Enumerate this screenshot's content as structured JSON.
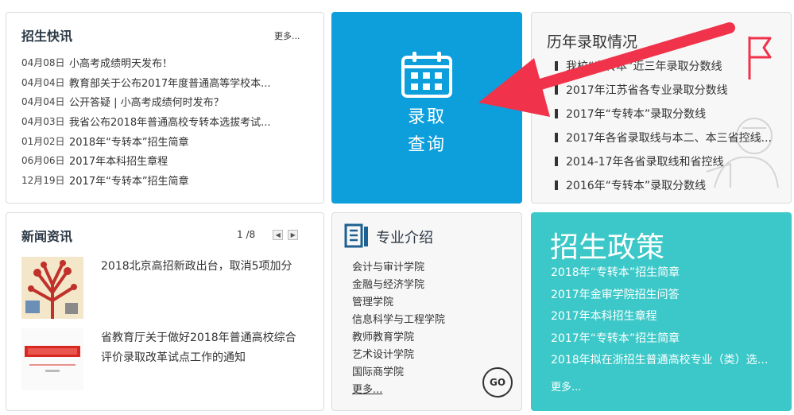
{
  "news_flash": {
    "title": "招生快讯",
    "more": "更多...",
    "items": [
      {
        "date": "04月08日",
        "text": "小高考成绩明天发布！"
      },
      {
        "date": "04月04日",
        "text": "教育部关于公布2017年度普通高等学校本..."
      },
      {
        "date": "04月04日",
        "text": "公开答疑 | 小高考成绩何时发布？"
      },
      {
        "date": "04月03日",
        "text": "我省公布2018年普通高校专转本选拔考试..."
      },
      {
        "date": "01月02日",
        "text": "2018年“专转本”招生简章"
      },
      {
        "date": "06月06日",
        "text": "2017年本科招生章程"
      },
      {
        "date": "12月19日",
        "text": "2017年“专转本”招生简章"
      }
    ]
  },
  "admission_query": {
    "line1": "录取",
    "line2": "查询",
    "icon": "calendar-icon",
    "color": "#0c9fdc"
  },
  "history": {
    "title": "历年录取情况",
    "items": [
      "我校“专转本”近三年录取分数线",
      "2017年江苏省各专业录取分数线",
      "2017年“专转本”录取分数线",
      "2017年各省录取线与本二、本三省控线...",
      "2014-17年各省录取线和省控线",
      "2016年“专转本”录取分数线"
    ],
    "icon": "flag-icon"
  },
  "news": {
    "title": "新闻资讯",
    "page_count": "1 /8",
    "items": [
      {
        "text": "2018北京高招新政出台，取消5项加分"
      },
      {
        "text": "省教育厅关于做好2018年普通高校综合评价录取改革试点工作的通知"
      }
    ]
  },
  "majors": {
    "title": "专业介绍",
    "items": [
      "会计与审计学院",
      "金融与经济学院",
      "管理学院",
      "信息科学与工程学院",
      "教师教育学院",
      "艺术设计学院",
      "国际商学院"
    ],
    "more": "更多...",
    "go": "GO",
    "icon": "book-icon"
  },
  "policy": {
    "title": "招生政策",
    "items": [
      "2018年“专转本”招生简章",
      "2017年金审学院招生问答",
      "2017年本科招生章程",
      "2017年“专转本”招生简章",
      "2018年拟在浙招生普通高校专业（类）选考..."
    ],
    "more": "更多...",
    "color": "#3cc8c8"
  },
  "annotation": {
    "arrow_color": "#f0334b"
  }
}
